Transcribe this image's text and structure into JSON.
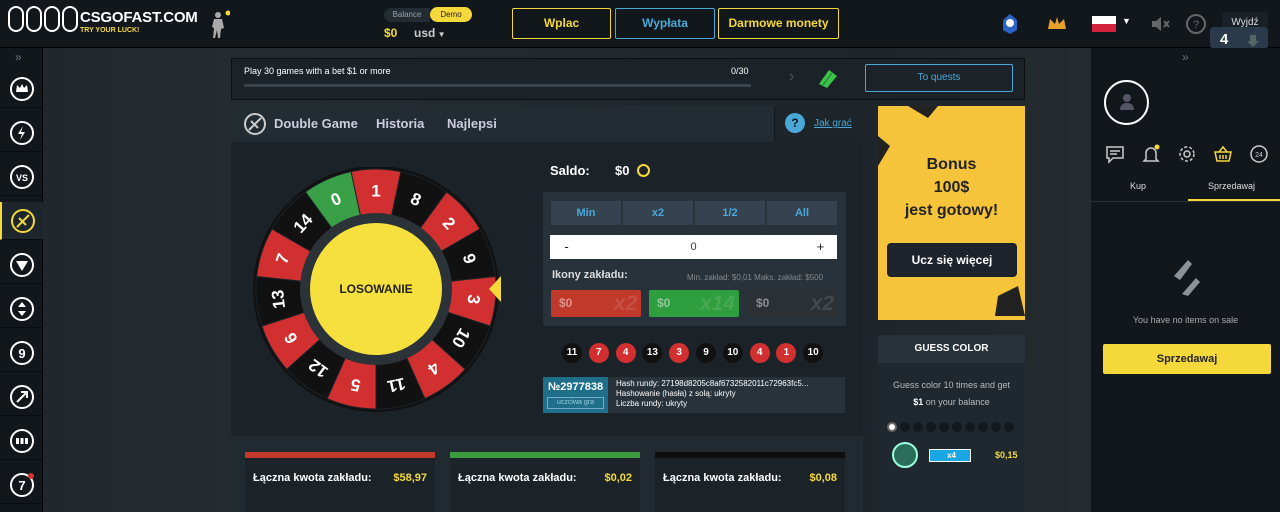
{
  "header": {
    "brand_name": "CSGOFAST.COM",
    "brand_tag": "TRY YOUR LUCK!",
    "balance_label": "Balance",
    "demo_label": "Demo",
    "balance_value": "$0",
    "currency": "usd",
    "wplac": "Wplac",
    "wyplata": "Wypłata",
    "free_coins": "Darmowe monety",
    "exit": "Wyjdź"
  },
  "quest": {
    "text": "Play 30 games with a bet $1 or more",
    "progress": "0/30",
    "progress_fraction": 0,
    "button": "To quests"
  },
  "game": {
    "tabs": [
      "Double Game",
      "Historia",
      "Najlepsi"
    ],
    "help_link": "Jak grać",
    "wheel_center": "LOSOWANIE",
    "wheel_numbers": [
      "1",
      "8",
      "2",
      "9",
      "3",
      "10",
      "4",
      "11",
      "5",
      "12",
      "6",
      "13",
      "7",
      "14",
      "0"
    ],
    "saldo_label": "Saldo:",
    "saldo_value": "$0",
    "quick": [
      "Min",
      "x2",
      "1/2",
      "All"
    ],
    "bet_value": "0",
    "minus": "-",
    "plus": "+",
    "icons_label": "Ikony zakładu:",
    "minmax": "Min. zakład: $0,01 Maks. zakład: $500",
    "chips": [
      {
        "value": "$0",
        "mult": "x2",
        "color": "#c0392b"
      },
      {
        "value": "$0",
        "mult": "x14",
        "color": "#2e9e3e"
      },
      {
        "value": "$0",
        "mult": "x2",
        "color": "#2b3034"
      }
    ],
    "history": [
      {
        "n": "11",
        "c": "#111"
      },
      {
        "n": "7",
        "c": "#d23030"
      },
      {
        "n": "4",
        "c": "#d23030"
      },
      {
        "n": "13",
        "c": "#111"
      },
      {
        "n": "3",
        "c": "#d23030"
      },
      {
        "n": "9",
        "c": "#111"
      },
      {
        "n": "10",
        "c": "#111"
      },
      {
        "n": "4",
        "c": "#d23030"
      },
      {
        "n": "1",
        "c": "#d23030"
      },
      {
        "n": "10",
        "c": "#111"
      }
    ],
    "round_id": "№2977838",
    "round_tag": "uczciwa gra",
    "hash_line": "Hash rundy: 27198d8205c8af6732582011c72963fc5...",
    "salt_line": "Hashowanie (hasła) z solą: ukryty",
    "round_num_line": "Liczba rundy: ukryty"
  },
  "bets": [
    {
      "label": "Łączna kwota zakładu:",
      "amount": "$58,97",
      "color": "#c0392b"
    },
    {
      "label": "Łączna kwota zakładu:",
      "amount": "$0,02",
      "color": "#3e9a3e"
    },
    {
      "label": "Łączna kwota zakładu:",
      "amount": "$0,08",
      "color": "#0e0e0e"
    }
  ],
  "ad": {
    "line1": "Bonus",
    "line2": "100$",
    "line3": "jest gotowy!",
    "button": "Ucz się więcej"
  },
  "guess": {
    "title": "GUESS COLOR",
    "desc1": "Guess color 10 times and get",
    "desc2_bold": "$1",
    "desc2_rest": " on your balance",
    "mult": "x4",
    "amount": "$0,15"
  },
  "right": {
    "tab_buy": "Kup",
    "tab_sell": "Sprzedawaj",
    "empty": "You have no items on sale",
    "sell_button": "Sprzedawaj"
  },
  "colors": {
    "accent": "#f5d93b",
    "blue": "#4aa8d8",
    "red": "#d23030",
    "green": "#3aa048"
  }
}
